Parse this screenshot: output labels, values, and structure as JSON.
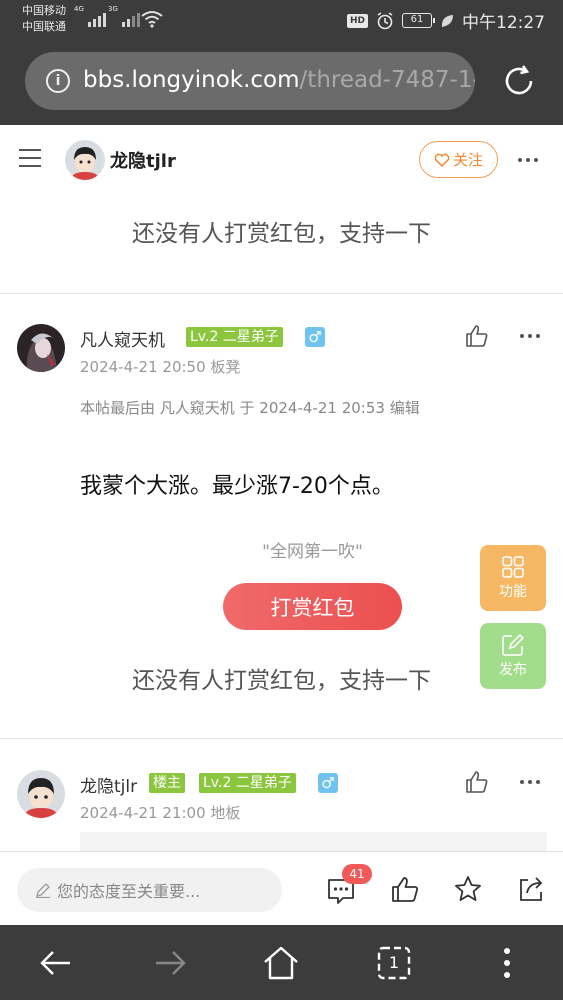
{
  "status_bar": {
    "carrier_1": "中国移动",
    "carrier_2": "中国联通",
    "net_1": "4G",
    "net_2": "3G",
    "hd": "HD",
    "battery": "61",
    "time": "中午12:27"
  },
  "address_bar": {
    "domain": "bbs.longyinok.com",
    "path": "/thread-7487-1-"
  },
  "header": {
    "author": "龙隐tjlr",
    "follow_label": "关注"
  },
  "reward_empty_text": "还没有人打赏红包，支持一下",
  "posts": [
    {
      "author": "凡人窥天机",
      "level_badge": "Lv.2 二星弟子",
      "gender": "♂",
      "meta": "2024-4-21 20:50 板凳",
      "edit_note": "本帖最后由 凡人窥天机 于 2024-4-21 20:53 编辑",
      "content": "我蒙个大涨。最少涨7-20个点。",
      "quote": "\"全网第一吹\"",
      "reward_button": "打赏红包",
      "reward_empty_text": "还没有人打赏红包，支持一下"
    },
    {
      "author": "龙隐tjlr",
      "owner_badge": "楼主",
      "level_badge": "Lv.2 二星弟子",
      "gender": "♂",
      "meta": "2024-4-21 21:00 地板"
    }
  ],
  "float_buttons": {
    "func_label": "功能",
    "publish_label": "发布"
  },
  "action_bar": {
    "comment_placeholder": "您的态度至关重要...",
    "comment_count": "41"
  },
  "nav_bar": {
    "tabs_count": "1"
  },
  "colors": {
    "accent_orange": "#f08a30",
    "reward_red": "#ec4f4f",
    "badge_green": "#8cc63e",
    "gender_blue": "#6fc3ee"
  }
}
